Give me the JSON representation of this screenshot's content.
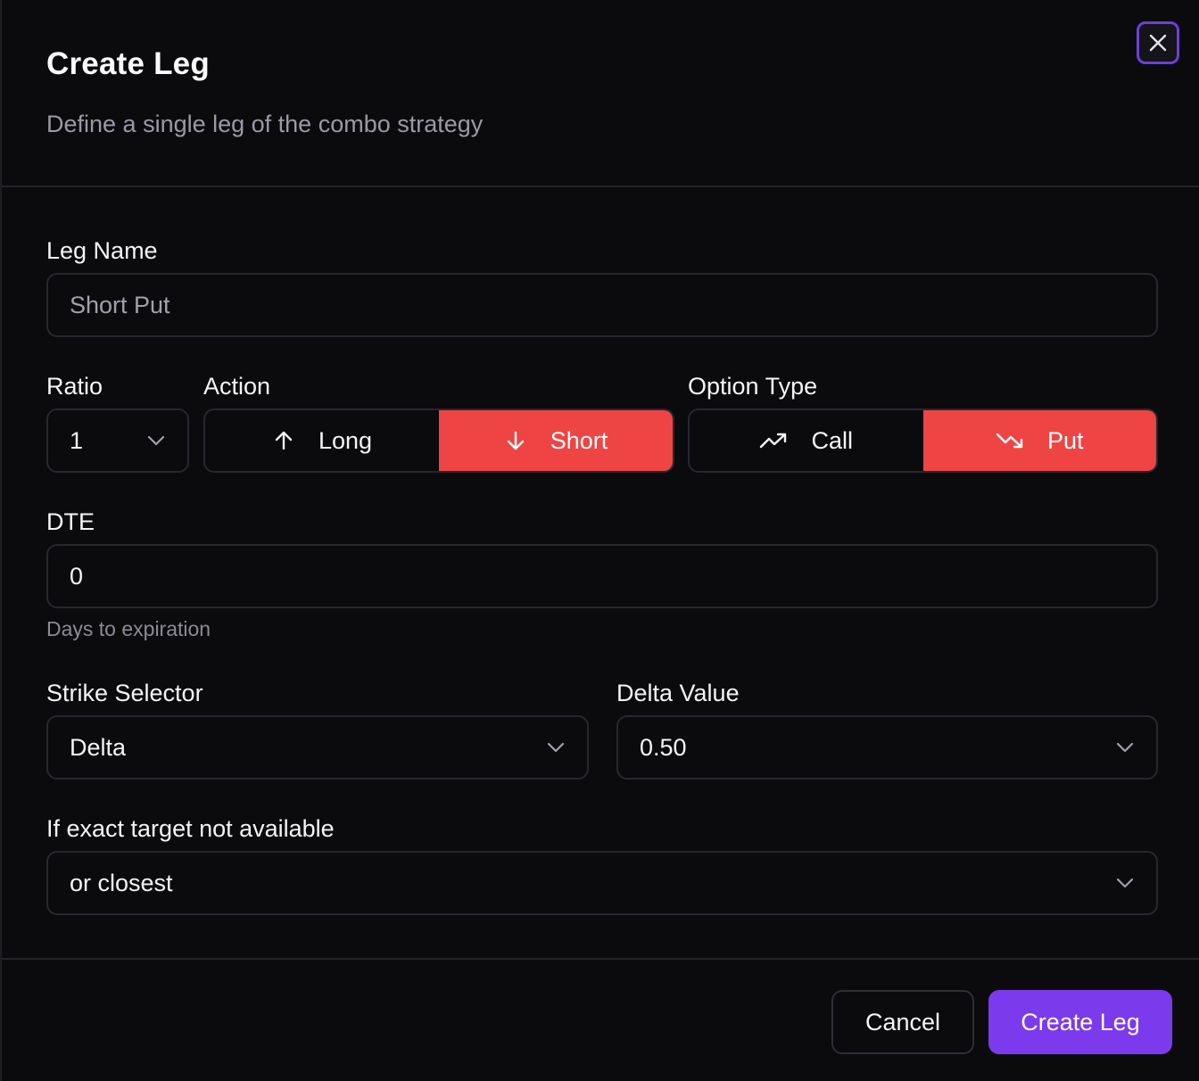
{
  "dialog": {
    "title": "Create Leg",
    "subtitle": "Define a single leg of the combo strategy"
  },
  "form": {
    "leg_name": {
      "label": "Leg Name",
      "value": "Short Put"
    },
    "ratio": {
      "label": "Ratio",
      "value": "1"
    },
    "action": {
      "label": "Action",
      "options": [
        {
          "label": "Long",
          "icon": "arrow-up-icon",
          "selected": false
        },
        {
          "label": "Short",
          "icon": "arrow-down-icon",
          "selected": true
        }
      ]
    },
    "option_type": {
      "label": "Option Type",
      "options": [
        {
          "label": "Call",
          "icon": "trending-up-icon",
          "selected": false
        },
        {
          "label": "Put",
          "icon": "trending-down-icon",
          "selected": true
        }
      ]
    },
    "dte": {
      "label": "DTE",
      "value": "0",
      "helper": "Days to expiration"
    },
    "strike_selector": {
      "label": "Strike Selector",
      "value": "Delta"
    },
    "delta_value": {
      "label": "Delta Value",
      "value": "0.50"
    },
    "fallback": {
      "label": "If exact target not available",
      "value": "or closest"
    }
  },
  "footer": {
    "cancel_label": "Cancel",
    "submit_label": "Create Leg"
  },
  "colors": {
    "accent": "#7c3aed",
    "danger": "#ef4444",
    "background": "#0b0b0e",
    "border": "#27272f"
  }
}
